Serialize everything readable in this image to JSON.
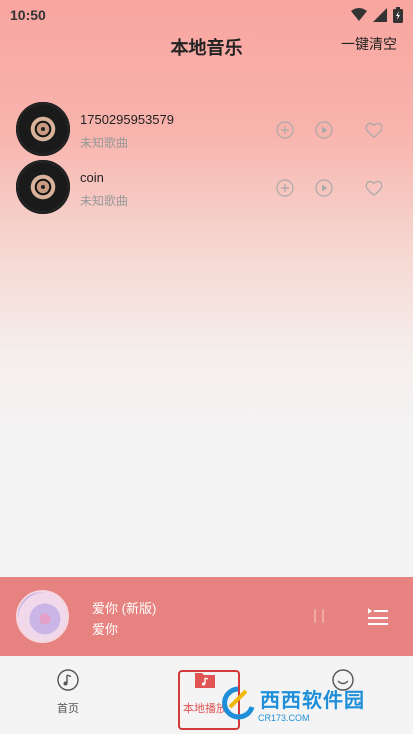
{
  "status_bar": {
    "time": "10:50"
  },
  "header": {
    "title": "本地音乐",
    "clear_label": "一键清空"
  },
  "songs": [
    {
      "name": "1750295953579",
      "artist": "未知歌曲"
    },
    {
      "name": "coin",
      "artist": "未知歌曲"
    }
  ],
  "now_playing": {
    "title": "爱你 (新版)",
    "artist": "爱你"
  },
  "nav": {
    "home_label": "首页",
    "local_label": "本地播放",
    "mine_label": ""
  },
  "watermark": {
    "brand": "西西软件园",
    "domain": "CR173.COM"
  },
  "colors": {
    "accent": "#e05454",
    "player_bar": "#e6827f"
  }
}
